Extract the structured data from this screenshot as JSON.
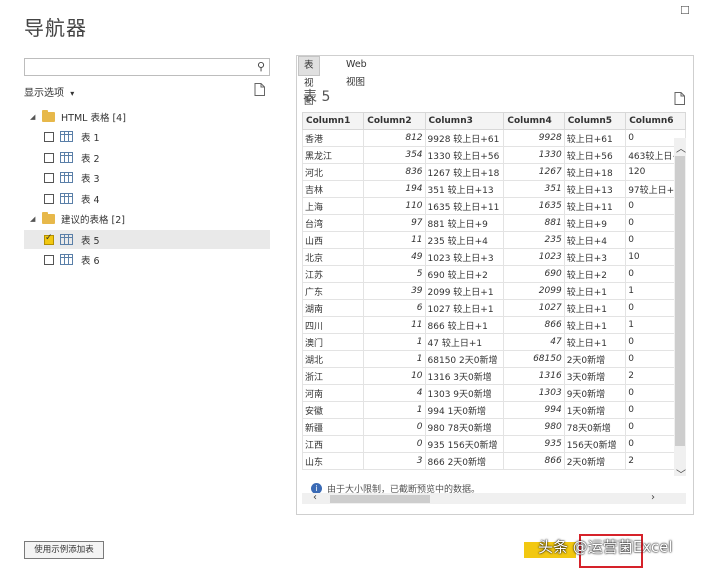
{
  "window": {
    "title": "导航器",
    "minimize_label": "—",
    "maximize_label": "☐"
  },
  "sidebar": {
    "search_placeholder": "",
    "options_label": "显示选项",
    "options_caret": "▾",
    "tree": {
      "groups": [
        {
          "label": "HTML 表格 [4]",
          "items": [
            {
              "label": "表 1",
              "checked": false
            },
            {
              "label": "表 2",
              "checked": false
            },
            {
              "label": "表 3",
              "checked": false
            },
            {
              "label": "表 4",
              "checked": false
            }
          ]
        },
        {
          "label": "建议的表格 [2]",
          "items": [
            {
              "label": "表 5",
              "checked": true
            },
            {
              "label": "表 6",
              "checked": false
            }
          ]
        }
      ]
    }
  },
  "preview": {
    "tabs": [
      {
        "label": "表视图",
        "active": true
      },
      {
        "label": "Web 视图",
        "active": false
      }
    ],
    "title": "表 5",
    "columns": [
      "Column1",
      "Column2",
      "Column3",
      "Column4",
      "Column5",
      "Column6"
    ],
    "rows": [
      [
        "香港",
        "812",
        "9928 较上日+61",
        "9928",
        "较上日+61",
        "0"
      ],
      [
        "黑龙江",
        "354",
        "1330 较上日+56",
        "1330",
        "较上日+56",
        "463较上日+"
      ],
      [
        "河北",
        "836",
        "1267 较上日+18",
        "1267",
        "较上日+18",
        "120"
      ],
      [
        "吉林",
        "194",
        "351 较上日+13",
        "351",
        "较上日+13",
        "97较上日+"
      ],
      [
        "上海",
        "110",
        "1635 较上日+11",
        "1635",
        "较上日+11",
        "0"
      ],
      [
        "台湾",
        "97",
        "881 较上日+9",
        "881",
        "较上日+9",
        "0"
      ],
      [
        "山西",
        "11",
        "235 较上日+4",
        "235",
        "较上日+4",
        "0"
      ],
      [
        "北京",
        "49",
        "1023 较上日+3",
        "1023",
        "较上日+3",
        "10"
      ],
      [
        "江苏",
        "5",
        "690 较上日+2",
        "690",
        "较上日+2",
        "0"
      ],
      [
        "广东",
        "39",
        "2099 较上日+1",
        "2099",
        "较上日+1",
        "1"
      ],
      [
        "湖南",
        "6",
        "1027 较上日+1",
        "1027",
        "较上日+1",
        "0"
      ],
      [
        "四川",
        "11",
        "866 较上日+1",
        "866",
        "较上日+1",
        "1"
      ],
      [
        "澳门",
        "1",
        "47 较上日+1",
        "47",
        "较上日+1",
        "0"
      ],
      [
        "湖北",
        "1",
        "68150 2天0新增",
        "68150",
        "2天0新增",
        "0"
      ],
      [
        "浙江",
        "10",
        "1316 3天0新增",
        "1316",
        "3天0新增",
        "2"
      ],
      [
        "河南",
        "4",
        "1303 9天0新增",
        "1303",
        "9天0新增",
        "0"
      ],
      [
        "安徽",
        "1",
        "994 1天0新增",
        "994",
        "1天0新增",
        "0"
      ],
      [
        "新疆",
        "0",
        "980 78天0新增",
        "980",
        "78天0新增",
        "0"
      ],
      [
        "江西",
        "0",
        "935 156天0新增",
        "935",
        "156天0新增",
        "0"
      ],
      [
        "山东",
        "3",
        "866 2天0新增",
        "866",
        "2天0新增",
        "2"
      ]
    ],
    "notice": "由于大小限制，已截断预览中的数据。"
  },
  "footer": {
    "sample_button": "使用示例添加表",
    "watermark": "头条 @运营菌Excel"
  },
  "colors": {
    "accent": "#f2c811",
    "highlight_box": "#d6222a"
  }
}
